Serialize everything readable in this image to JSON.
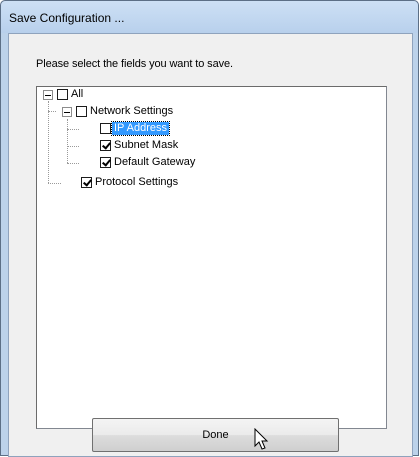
{
  "window": {
    "title": "Save Configuration ..."
  },
  "dialog": {
    "instruction": "Please select the fields you want to save.",
    "done_label": "Done"
  },
  "tree": {
    "root": {
      "label": "All",
      "checked": false
    },
    "network": {
      "label": "Network Settings",
      "checked": false
    },
    "ip": {
      "label": "IP Address",
      "checked": false,
      "selected": true
    },
    "subnet": {
      "label": "Subnet Mask",
      "checked": true
    },
    "gateway": {
      "label": "Default Gateway",
      "checked": true
    },
    "protocol": {
      "label": "Protocol Settings",
      "checked": true
    }
  },
  "colors": {
    "selection": "#3399ff",
    "frame": "#bcd2ea"
  },
  "icons": [
    "collapse-icon",
    "checkbox-icon",
    "mouse-cursor-icon"
  ]
}
